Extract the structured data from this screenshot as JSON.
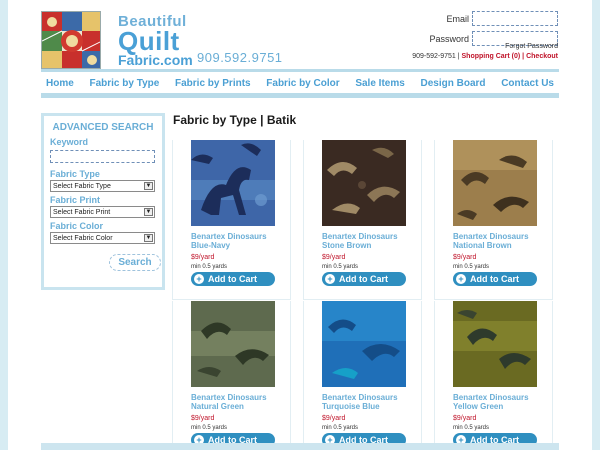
{
  "brand": {
    "line1": "Beautiful",
    "line2": "Quilt",
    "line3": "Fabric.com",
    "phone": "909.592.9751"
  },
  "login": {
    "email_label": "Email",
    "password_label": "Password",
    "forgot": "Forgot Password"
  },
  "toplinks": {
    "phone": "909-592-9751",
    "sep1": " | ",
    "cart": "Shopping Cart (0)",
    "sep2": " | ",
    "checkout": "Checkout"
  },
  "nav": [
    "Home",
    "Fabric by Type",
    "Fabric by Prints",
    "Fabric by Color",
    "Sale Items",
    "Design Board",
    "Contact Us"
  ],
  "sidebar": {
    "title": "ADVANCED SEARCH",
    "keyword_label": "Keyword",
    "type_label": "Fabric Type",
    "type_value": "Select Fabric Type",
    "print_label": "Fabric Print",
    "print_value": "Select Fabric Print",
    "color_label": "Fabric Color",
    "color_value": "Select Fabric Color",
    "search_button": "Search"
  },
  "content_title": "Fabric by Type | Batik",
  "products": [
    {
      "line1": "Benartex Dinosaurs",
      "line2": "Blue-Navy",
      "price": "$9/yard",
      "min": "min 0.5 yards",
      "cart": "Add to Cart"
    },
    {
      "line1": "Benartex Dinosaurs",
      "line2": "Stone Brown",
      "price": "$9/yard",
      "min": "min 0.5 yards",
      "cart": "Add to Cart"
    },
    {
      "line1": "Benartex Dinosaurs",
      "line2": "National Brown",
      "price": "$9/yard",
      "min": "min 0.5 yards",
      "cart": "Add to Cart"
    },
    {
      "line1": "Benartex Dinosaurs",
      "line2": "Natural Green",
      "price": "$9/yard",
      "min": "min 0.5 yards",
      "cart": "Add to Cart"
    },
    {
      "line1": "Benartex Dinosaurs",
      "line2": "Turquoise Blue",
      "price": "$9/yard",
      "min": "min 0.5 yards",
      "cart": "Add to Cart"
    },
    {
      "line1": "Benartex Dinosaurs",
      "line2": "Yellow Green",
      "price": "$9/yard",
      "min": "min 0.5 yards",
      "cart": "Add to Cart"
    }
  ],
  "colors": {
    "accent": "#4aa0d6",
    "cart_button": "#2f8fc0",
    "price": "#c0142a"
  }
}
